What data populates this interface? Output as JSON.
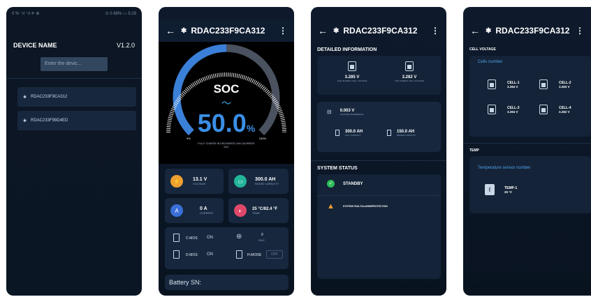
{
  "screen1": {
    "status_left": "0 % ⁺ıl ⁺ıl ✈ ⊕",
    "status_right": "⊙ 0 88% ▭ 5:19",
    "header_title": "DEVICE NAME",
    "version": "V1.2.0",
    "search_placeholder": "Enter the devic...",
    "devices": [
      "RDAC233F9CA312",
      "RDAC233F99D4ED"
    ]
  },
  "screen2": {
    "title": "RDAC233F9CA312",
    "soc_label": "SOC",
    "soc_value": "50.0",
    "soc_unit": "%",
    "gauge_min": "0%",
    "gauge_max": "100%",
    "gauge_fraction": 0.5,
    "gauge_note": "FULLY CHARGE IN DISCHARGE CAN CALIBRATE SOC",
    "stats": [
      {
        "value": "13.1 V",
        "label": "VOLTAGE",
        "color": "#f0a030"
      },
      {
        "value": "300.0 AH",
        "label": "RATED CAPACITY",
        "color": "#23b59a"
      },
      {
        "value": "0 A",
        "label": "CURRENT",
        "color": "#3a6fd8"
      },
      {
        "value": "25 °C/82.4 °F",
        "label": "TEMP",
        "color": "#e0486a"
      }
    ],
    "cmos_label": "C-MOS",
    "cmos_state": "ON",
    "dmos_label": "D-MOS",
    "dmos_state": "ON",
    "idle_value": "0",
    "idle_label": "IDLE",
    "hmode_label": "H-MODE",
    "hmode_state": "OFF",
    "battery_sn_label": "Battery SN:"
  },
  "screen3": {
    "title": "RDAC233F9CA312",
    "detailed_title": "DETAILED INFORMATION",
    "highest_value": "3.285 V",
    "highest_label": "THE HIGHEST CELL VOLTAGE",
    "lowest_value": "3.282 V",
    "lowest_label": "THE LOWEST CELL VOLTAGE",
    "diff_value": "0.003 V",
    "diff_label": "VOLTAGE DIFFERENCE",
    "full_value": "300.0 AH",
    "full_label": "FULL CAPACITY",
    "remain_value": "150.0 AH",
    "remain_label": "REMAIN CAPACITY",
    "status_title": "SYSTEM STATUS",
    "standby": "STANDBY",
    "fault": "SYSTEM FAULT/ALARM/PROTECTION"
  },
  "screen4": {
    "title": "RDAC233F9CA312",
    "cell_title": "CELL VOLTAGE",
    "cells_number_label": "Cells number",
    "cells": [
      {
        "name": "CELL-1",
        "value": "3.284 V"
      },
      {
        "name": "CELL-2",
        "value": "3.283 V"
      },
      {
        "name": "CELL-3",
        "value": "3.284 V"
      },
      {
        "name": "CELL-4",
        "value": "3.282 V"
      }
    ],
    "temp_title": "TEMP",
    "temp_sensor_label": "Temperature sensor number",
    "temp_name": "TEMP-1",
    "temp_value": "25 °C"
  }
}
